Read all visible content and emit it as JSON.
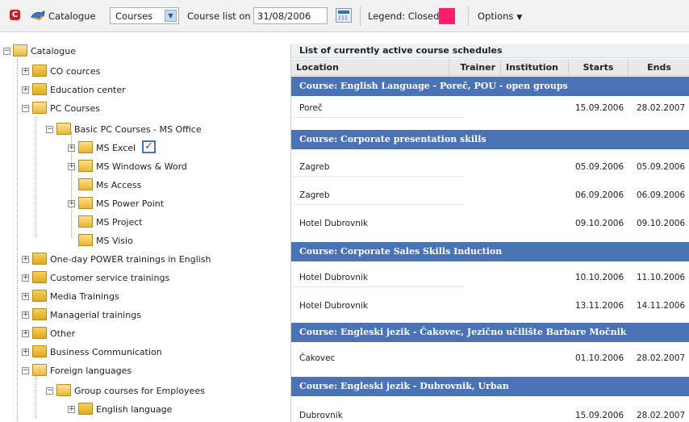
{
  "toolbar": {
    "back_glyph": "C",
    "catalogue_label": "Catalogue",
    "type_select": "Courses",
    "course_list_label": "Course list on :",
    "date_value": "31/08/2006",
    "legend_label": "Legend: Closed",
    "legend_color": "#ff1c6e",
    "options_label": "Options"
  },
  "tree": {
    "root": "Catalogue",
    "items": [
      {
        "label": "CO cources"
      },
      {
        "label": "Education center"
      },
      {
        "label": "PC Courses"
      },
      {
        "label": "Basic PC Courses - MS Office"
      },
      {
        "label": "MS Excel"
      },
      {
        "label": "MS Windows & Word"
      },
      {
        "label": "Ms Access"
      },
      {
        "label": "MS Power Point"
      },
      {
        "label": "MS Project"
      },
      {
        "label": "MS Visio"
      },
      {
        "label": "One-day POWER trainings in English"
      },
      {
        "label": "Customer service trainings"
      },
      {
        "label": "Media Trainings"
      },
      {
        "label": "Managerial trainings"
      },
      {
        "label": "Other"
      },
      {
        "label": "Business Communication"
      },
      {
        "label": "Foreign languages"
      },
      {
        "label": "Group courses for Employees"
      },
      {
        "label": "English language"
      }
    ]
  },
  "schedule": {
    "title": "List of currently active course schedules",
    "columns": {
      "location": "Location",
      "trainer": "Trainer",
      "institution": "Institution",
      "starts": "Starts",
      "ends": "Ends"
    },
    "groups": [
      {
        "course": "Course: English Language - Poreč, POU - open groups",
        "rows": [
          {
            "location": "Poreč",
            "starts": "15.09.2006",
            "ends": "28.02.2007"
          }
        ]
      },
      {
        "course": "Course: Corporate presentation skills",
        "rows": [
          {
            "location": "Zagreb",
            "starts": "05.09.2006",
            "ends": "05.09.2006"
          },
          {
            "location": "Zagreb",
            "starts": "06.09.2006",
            "ends": "06.09.2006"
          },
          {
            "location": "Hotel Dubrovnik",
            "starts": "09.10.2006",
            "ends": "09.10.2006"
          }
        ]
      },
      {
        "course": "Course: Corporate Sales Skills Induction",
        "rows": [
          {
            "location": "Hotel Dubrovnik",
            "starts": "10.10.2006",
            "ends": "11.10.2006"
          },
          {
            "location": "Hotel Dubrovnik",
            "starts": "13.11.2006",
            "ends": "14.11.2006"
          }
        ]
      },
      {
        "course": "Course: Engleski jezik - Čakovec, Jezično učilište Barbare Močnik",
        "rows": [
          {
            "location": "Čakovec",
            "starts": "01.10.2006",
            "ends": "28.02.2007"
          }
        ]
      },
      {
        "course": "Course: Engleski jezik - Dubrovnik, Urban",
        "rows": [
          {
            "location": "Dubrovnik",
            "starts": "15.09.2006",
            "ends": "28.02.2007"
          }
        ]
      }
    ]
  },
  "icons": {
    "back": "back-icon",
    "catalogue": "catalogue-icon",
    "calendar": "calendar-icon",
    "folder": "folder-icon",
    "checked": "checkbox-checked-icon"
  }
}
